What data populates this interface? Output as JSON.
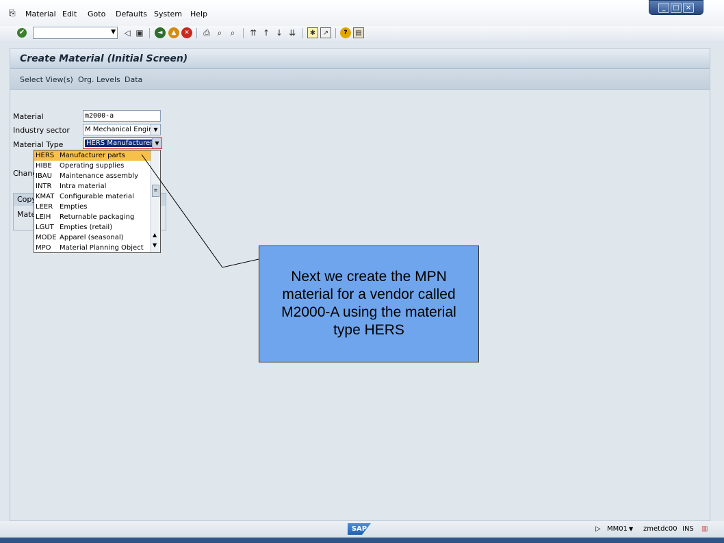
{
  "menubar": {
    "items": [
      "Material",
      "Edit",
      "Goto",
      "Defaults",
      "System",
      "Help"
    ]
  },
  "window": {
    "minimize_glyph": "_",
    "restore_glyph": "□",
    "close_glyph": "×"
  },
  "toolbar": {
    "command_field": {
      "value": "",
      "placeholder": ""
    }
  },
  "screen": {
    "title": "Create Material (Initial Screen)",
    "app_toolbar": [
      "Select View(s)",
      "Org. Levels",
      "Data"
    ]
  },
  "form": {
    "material_label": "Material",
    "material_value": "m2000-a",
    "industry_label": "Industry sector",
    "industry_value": "M Mechanical Engin…",
    "type_label": "Material Type",
    "type_value": "HERS Manufacturer …",
    "change_label_partial": "Chang",
    "copy_tab_partial": "Copy",
    "copy_material_partial": "Mate"
  },
  "dropdown": {
    "options": [
      {
        "code": "HERS",
        "desc": "Manufacturer parts",
        "selected": true
      },
      {
        "code": "HIBE",
        "desc": "Operating supplies"
      },
      {
        "code": "IBAU",
        "desc": "Maintenance assembly"
      },
      {
        "code": "INTR",
        "desc": "Intra material"
      },
      {
        "code": "KMAT",
        "desc": "Configurable material"
      },
      {
        "code": "LEER",
        "desc": "Empties"
      },
      {
        "code": "LEIH",
        "desc": "Returnable packaging"
      },
      {
        "code": "LGUT",
        "desc": "Empties (retail)"
      },
      {
        "code": "MODE",
        "desc": "Apparel (seasonal)"
      },
      {
        "code": "MPO",
        "desc": "Material Planning Object"
      }
    ]
  },
  "callout": {
    "text": "Next we create the MPN material for a vendor called M2000-A using the material type HERS"
  },
  "statusbar": {
    "logo": "SAP",
    "transaction": "MM01",
    "server": "zmetdc00",
    "mode": "INS"
  }
}
